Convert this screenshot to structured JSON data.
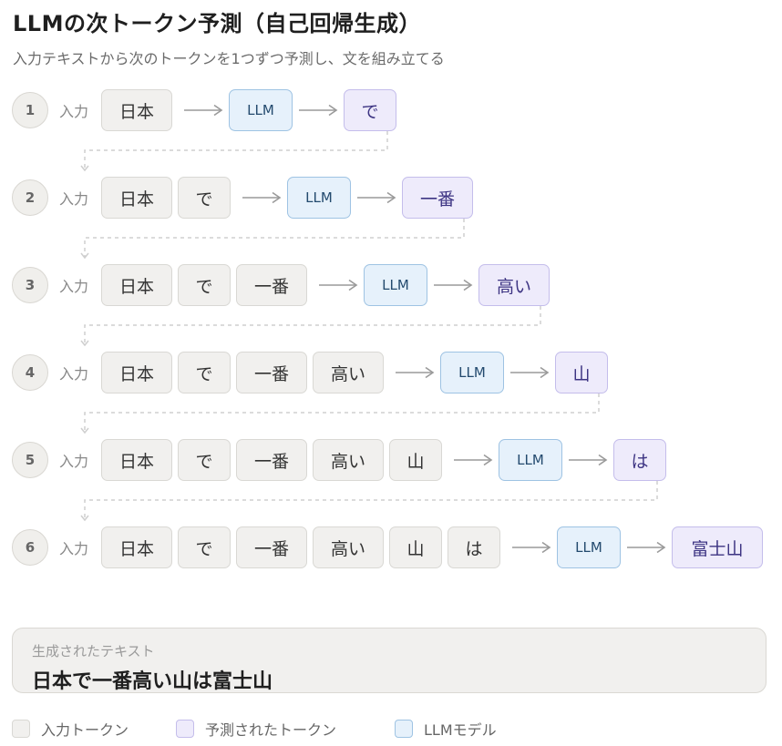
{
  "title": "LLMの次トークン予測（自己回帰生成）",
  "subtitle": "入力テキストから次のトークンを1つずつ予測し、文を組み立てる",
  "input_label": "入力",
  "llm_label": "LLM",
  "steps": [
    {
      "num": "1",
      "inputs": [
        "日本"
      ],
      "predicted": "で"
    },
    {
      "num": "2",
      "inputs": [
        "日本",
        "で"
      ],
      "predicted": "一番"
    },
    {
      "num": "3",
      "inputs": [
        "日本",
        "で",
        "一番"
      ],
      "predicted": "高い"
    },
    {
      "num": "4",
      "inputs": [
        "日本",
        "で",
        "一番",
        "高い"
      ],
      "predicted": "山"
    },
    {
      "num": "5",
      "inputs": [
        "日本",
        "で",
        "一番",
        "高い",
        "山"
      ],
      "predicted": "は"
    },
    {
      "num": "6",
      "inputs": [
        "日本",
        "で",
        "一番",
        "高い",
        "山",
        "は"
      ],
      "predicted": "富士山"
    }
  ],
  "result": {
    "label": "生成されたテキスト",
    "text": "日本で一番高い山は富士山"
  },
  "legend": [
    {
      "label": "入力トークン",
      "kind": "input"
    },
    {
      "label": "予測されたトークン",
      "kind": "predicted"
    },
    {
      "label": "LLMモデル",
      "kind": "llm"
    }
  ],
  "colors": {
    "input_bg": "#f1f0ee",
    "predicted_bg": "#eeebfb",
    "llm_bg": "#e6f1fb"
  }
}
